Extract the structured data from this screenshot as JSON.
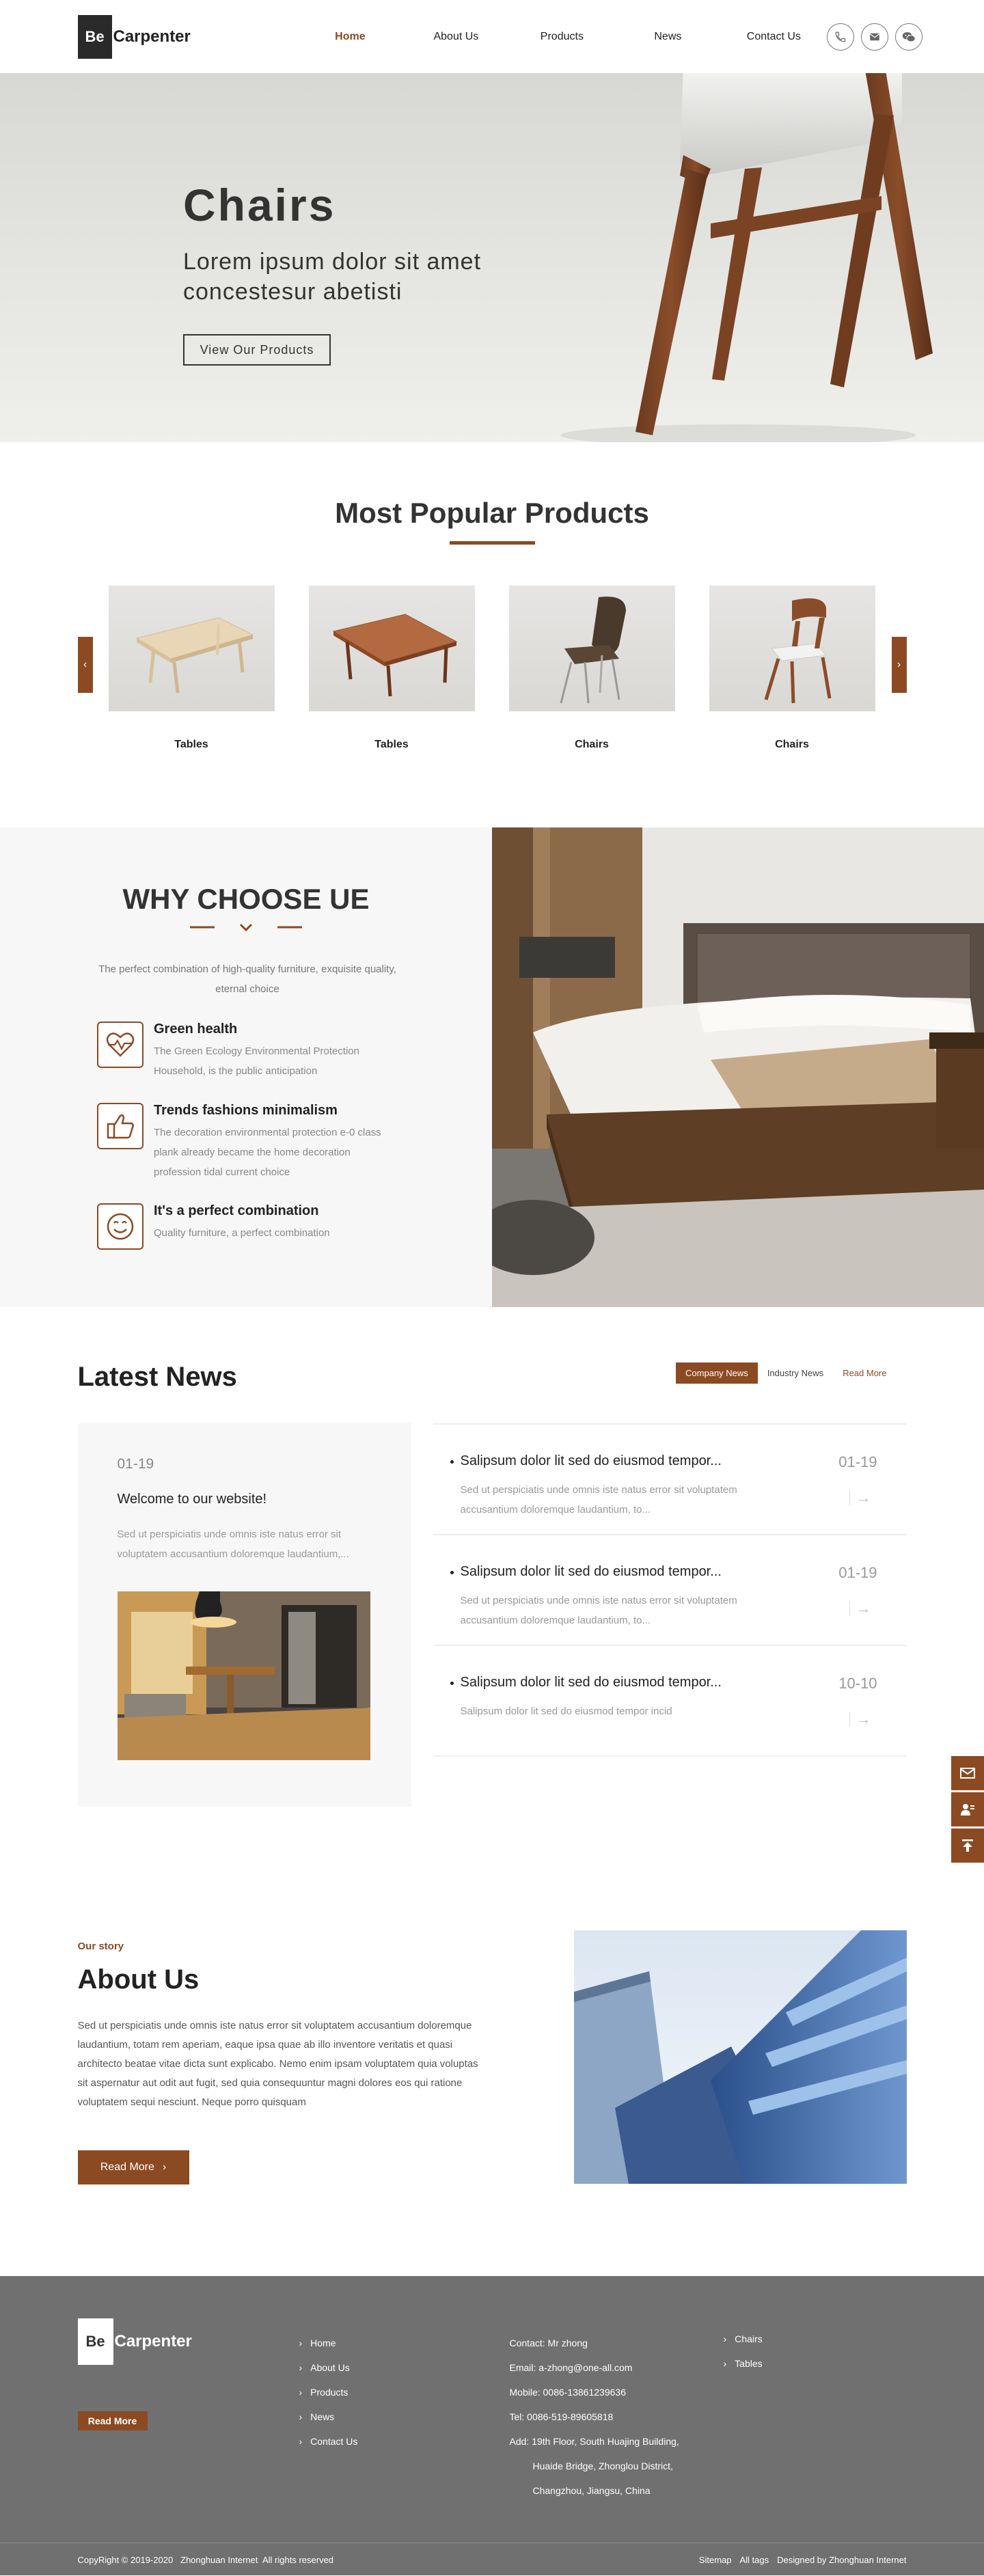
{
  "header": {
    "logo_box": "Be",
    "logo_text": "Carpenter",
    "nav": [
      "Home",
      "About Us",
      "Products",
      "News",
      "Contact Us"
    ],
    "social_icons": [
      "phone-icon",
      "mail-icon",
      "wechat-icon"
    ]
  },
  "hero": {
    "title": "Chairs",
    "subtitle": "Lorem ipsum dolor sit amet concestesur abetisti",
    "button": "View Our Products",
    "slides": 2,
    "active_slide": 1
  },
  "popular": {
    "title": "Most Popular Products",
    "products": [
      {
        "name": "Tables",
        "image": "light-wood-table"
      },
      {
        "name": "Tables",
        "image": "dark-wood-table"
      },
      {
        "name": "Chairs",
        "image": "dark-wood-chair"
      },
      {
        "name": "Chairs",
        "image": "white-wood-chair"
      }
    ]
  },
  "why": {
    "title": "WHY CHOOSE UE",
    "desc": "The perfect combination of high-quality furniture, exquisite quality, eternal choice",
    "features": [
      {
        "title": "Green health",
        "text": "The Green Ecology Environmental Protection Household, is the public anticipation",
        "icon": "heart-pulse-icon"
      },
      {
        "title": "Trends fashions minimalism",
        "text": "The decoration environmental protection e-0 class plank already became the home decoration profession tidal current choice",
        "icon": "thumbs-up-icon"
      },
      {
        "title": "It's a perfect combination",
        "text": "Quality furniture, a perfect combination",
        "icon": "smile-icon"
      }
    ]
  },
  "news": {
    "title": "Latest News",
    "tabs": [
      "Company News",
      "Industry News",
      "Read More"
    ],
    "featured": {
      "date": "01-19",
      "title": "Welcome to our website!",
      "text": "Sed ut perspiciatis unde omnis iste natus error sit voluptatem accusantium doloremque laudantium,..."
    },
    "items": [
      {
        "title": "Salipsum dolor lit sed do eiusmod tempor...",
        "text": "Sed ut perspiciatis unde omnis iste natus error sit voluptatem accusantium doloremque laudantium, to...",
        "date": "01-19"
      },
      {
        "title": "Salipsum dolor lit sed do eiusmod tempor...",
        "text": "Sed ut perspiciatis unde omnis iste natus error sit voluptatem accusantium doloremque laudantium, to...",
        "date": "01-19"
      },
      {
        "title": "Salipsum dolor lit sed do eiusmod tempor...",
        "text": "Salipsum dolor lit sed do eiusmod tempor incid",
        "date": "10-10"
      }
    ]
  },
  "about": {
    "story": "Our story",
    "title": "About Us",
    "text": "Sed ut perspiciatis unde omnis iste natus error sit voluptatem accusantium doloremque laudantium, totam rem aperiam, eaque ipsa quae ab illo inventore veritatis et quasi architecto beatae vitae dicta sunt explicabo. Nemo enim ipsam voluptatem quia voluptas sit aspernatur aut odit aut fugit, sed quia consequuntur magni dolores eos qui ratione voluptatem sequi nesciunt. Neque porro quisquam",
    "button": "Read More"
  },
  "footer": {
    "logo_box": "Be",
    "logo_text": "Carpenter",
    "read_more": "Read More",
    "links": [
      "Home",
      "About Us",
      "Products",
      "News",
      "Contact Us"
    ],
    "contact": {
      "contact": "Contact: Mr zhong",
      "email": "Email: a-zhong@one-all.com",
      "mobile": "Mobile: 0086-13861239636",
      "tel": "Tel: 0086-519-89605818",
      "addr1": "Add: 19th Floor, South Huajing Building,",
      "addr2": "Huaide Bridge, Zhonglou District,",
      "addr3": "Changzhou, Jiangsu, China"
    },
    "categories": [
      "Chairs",
      "Tables"
    ],
    "copyright": "CopyRight © 2019-2020   Zhonghuan Internet  All rights reserved",
    "bottom_links": [
      "Sitemap",
      "All tags",
      "Designed by Zhonghuan Internet"
    ]
  },
  "side": [
    "mail-icon",
    "user-service-icon",
    "back-to-top-icon"
  ],
  "colors": {
    "accent": "#8c4a22",
    "footer_bg": "#707070",
    "light_bg": "#f7f7f7"
  }
}
